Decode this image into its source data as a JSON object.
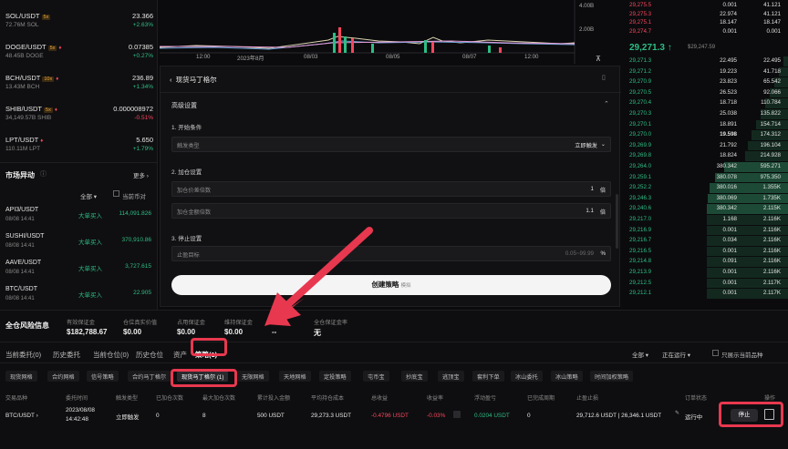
{
  "tickers": [
    {
      "sym": "SOL/USDT",
      "lev": "5x",
      "sub": "72.76M SOL",
      "price": "23.366",
      "chg": "+2.63%",
      "up": true
    },
    {
      "sym": "DOGE/USDT",
      "lev": "5x",
      "sub": "48.45B DOGE",
      "price": "0.07385",
      "chg": "+0.27%",
      "up": true
    },
    {
      "sym": "BCH/USDT",
      "lev": "10x",
      "sub": "13.43M BCH",
      "price": "236.89",
      "chg": "+1.34%",
      "up": true
    },
    {
      "sym": "SHIB/USDT",
      "lev": "5x",
      "sub": "34,149.57B SHIB",
      "price": "0.000008972",
      "chg": "-0.51%",
      "up": false
    },
    {
      "sym": "LPT/USDT",
      "lev": "",
      "sub": "110.11M LPT",
      "price": "5.650",
      "chg": "+1.79%",
      "up": true
    }
  ],
  "movers": {
    "title": "市场异动",
    "more": "更多 ›",
    "filter": "全部",
    "current": "当前币对",
    "rows": [
      {
        "sym": "API3/USDT",
        "time": "08/08 14:41",
        "kind": "大单买入",
        "val": "114,091.826"
      },
      {
        "sym": "SUSHI/USDT",
        "time": "08/08 14:41",
        "kind": "大单买入",
        "val": "370,910.86"
      },
      {
        "sym": "AAVE/USDT",
        "time": "08/08 14:41",
        "kind": "大单买入",
        "val": "3,727.615"
      },
      {
        "sym": "BTC/USDT",
        "time": "08/08 14:41",
        "kind": "大单买入",
        "val": "22.905"
      }
    ]
  },
  "chart": {
    "vol_labels": [
      "4.00B",
      "2.00B"
    ],
    "xticks": [
      "12:00",
      "2023年8月",
      "08/03",
      "08/05",
      "08/07",
      "12:00"
    ]
  },
  "modal": {
    "title": "现货马丁格尔",
    "advanced": "高级设置",
    "s1": "1. 开始条件",
    "trigger_l": "触发类型",
    "trigger_v": "立即触发",
    "s2": "2. 加仓设置",
    "f1_l": "加仓价差倍数",
    "f1_v": "1",
    "f1_u": "倍",
    "f2_l": "加仓金额倍数",
    "f2_v": "1.1",
    "f2_u": "倍",
    "s3": "3. 停止设置",
    "tp_l": "止盈目标",
    "tp_v": "0.05~99.99",
    "tp_u": "%",
    "create": "创建策略",
    "create_sub": "模拟"
  },
  "book": {
    "asks": [
      [
        "29,275.5",
        "0.001",
        "41.121"
      ],
      [
        "29,275.3",
        "22.974",
        "41.121"
      ],
      [
        "29,275.1",
        "18.147",
        "18.147"
      ],
      [
        "29,274.7",
        "0.001",
        "0.001"
      ]
    ],
    "mid": "29,271.3",
    "mid_arrow": "↑",
    "mid_sub": "$29,247.59",
    "bids": [
      [
        "29,271.3",
        "22.495",
        "22.495"
      ],
      [
        "29,271.2",
        "19.223",
        "41.718"
      ],
      [
        "29,270.9",
        "23.823",
        "65.542"
      ],
      [
        "29,270.5",
        "26.523",
        "92.066"
      ],
      [
        "29,270.4",
        "18.718",
        "110.784"
      ],
      [
        "29,270.3",
        "25.038",
        "135.822"
      ],
      [
        "29,270.1",
        "18.891",
        "154.714"
      ],
      [
        "29,270.0",
        "19.598",
        "174.312"
      ],
      [
        "29,269.9",
        "21.792",
        "196.104"
      ],
      [
        "29,269.8",
        "18.824",
        "214.928"
      ],
      [
        "29,264.0",
        "380.342",
        "595.271"
      ],
      [
        "29,259.1",
        "380.078",
        "975.350"
      ],
      [
        "29,252.2",
        "380.016",
        "1.355K"
      ],
      [
        "29,246.3",
        "380.069",
        "1.735K"
      ],
      [
        "29,240.6",
        "380.342",
        "2.115K"
      ],
      [
        "29,217.0",
        "1.168",
        "2.116K"
      ],
      [
        "29,216.9",
        "0.001",
        "2.116K"
      ],
      [
        "29,216.7",
        "0.034",
        "2.116K"
      ],
      [
        "29,216.5",
        "0.001",
        "2.116K"
      ],
      [
        "29,214.8",
        "0.091",
        "2.116K"
      ],
      [
        "29,213.9",
        "0.001",
        "2.116K"
      ],
      [
        "29,212.5",
        "0.001",
        "2.117K"
      ],
      [
        "29,212.1",
        "0.001",
        "2.117K"
      ]
    ]
  },
  "bottom": {
    "title": "全仓风险信息",
    "stats": [
      {
        "a": "有效保证金",
        "b": "$182,788.67"
      },
      {
        "a": "仓位真实价值",
        "b": "$0.00"
      },
      {
        "a": "占用保证金",
        "b": "$0.00"
      },
      {
        "a": "维持保证金",
        "b": "$0.00"
      },
      {
        "a": "杠杆",
        "b": "--"
      },
      {
        "a": "全仓保证金率",
        "b": "无"
      }
    ],
    "tabs": [
      "当前委托(0)",
      "历史委托",
      "当前仓位(0)",
      "历史仓位",
      "资产",
      "策略(1)"
    ],
    "filter_all": "全部",
    "filter_run": "正在运行",
    "only_cur": "只展示当前品种",
    "chips": [
      "现货网格",
      "合约网格",
      "信号策略",
      "合约马丁格尔",
      "现货马丁格尔 (1)",
      "无限网格",
      "天地网格",
      "定投策略",
      "屯币宝",
      "抄底宝",
      "逃顶宝",
      "套利下单",
      "冰山委托",
      "冰山策略",
      "时间加权策略"
    ],
    "headers": [
      "交易品种",
      "委托时间",
      "触发类型",
      "已加仓次数",
      "最大加仓次数",
      "累计投入金额",
      "平均持仓成本",
      "总收益",
      "收益率",
      "浮动盈亏",
      "已完成周期",
      "止盈止损",
      "订单状态",
      "操作"
    ],
    "row": {
      "sym": "BTC/USDT ›",
      "time1": "2023/08/08",
      "time2": "14:42:48",
      "trig": "立即触发",
      "done": "0",
      "max": "8",
      "inv": "500 USDT",
      "avg": "29,273.3 USDT",
      "pnl": "-0.4796 USDT",
      "rate": "-0.03%",
      "float": "0.0204 USDT",
      "cyc": "0",
      "tpsl": "29,712.6 USDT | 26,346.1 USDT",
      "status": "运行中",
      "stop": "停止"
    }
  }
}
